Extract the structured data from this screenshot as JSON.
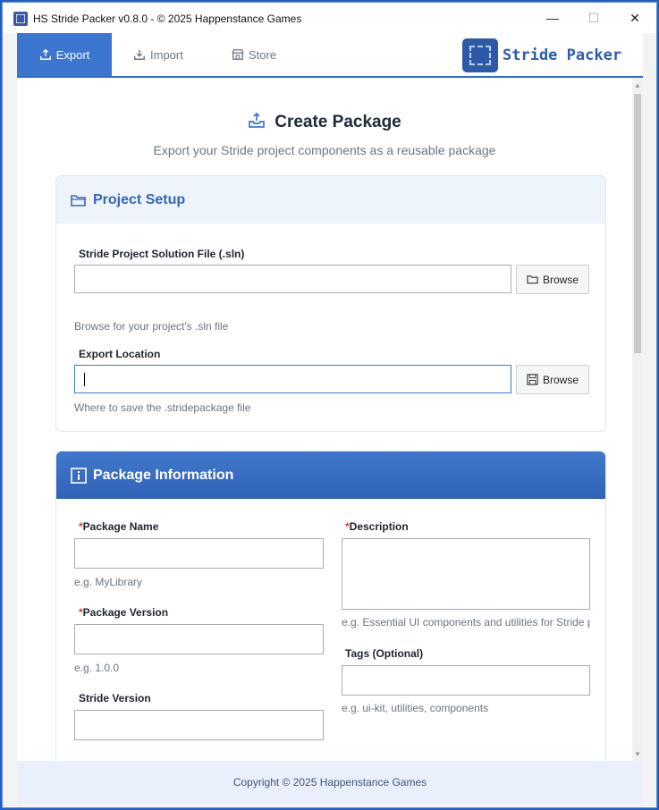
{
  "window": {
    "title": "HS Stride Packer v0.8.0 - © 2025 Happenstance Games",
    "min": "—",
    "max": "☐",
    "close": "✕"
  },
  "nav": {
    "tabs": [
      {
        "label": "Export",
        "icon": "upload-tray-icon",
        "active": true
      },
      {
        "label": "Import",
        "icon": "download-tray-icon",
        "active": false
      },
      {
        "label": "Store",
        "icon": "store-icon",
        "active": false
      }
    ],
    "brand": "Stride Packer"
  },
  "page": {
    "title": "Create Package",
    "subtitle": "Export your Stride project components as a reusable package"
  },
  "project_setup": {
    "heading": "Project Setup",
    "sln_label": "Stride Project Solution File (.sln)",
    "sln_value": "",
    "sln_hint": "Browse for your project's .sln file",
    "browse1": "Browse",
    "export_label": "Export Location",
    "export_value": "",
    "export_hint": "Where to save the .stridepackage file",
    "browse2": "Browse"
  },
  "package_info": {
    "heading": "Package Information",
    "required_mark": "*",
    "name_label": "Package Name",
    "name_hint": "e.g. MyLibrary",
    "version_label": "Package Version",
    "version_hint": "e.g. 1.0.0",
    "stride_version_label": "Stride Version",
    "description_label": "Description",
    "description_hint": "e.g. Essential UI components and utilities for Stride p",
    "tags_label": "Tags (Optional)",
    "tags_hint": "e.g. ui-kit, utilities, components"
  },
  "footer": {
    "text": "Copyright © 2025 Happenstance Games"
  },
  "colors": {
    "accent": "#3d76d1",
    "brand": "#2e5bae",
    "required": "#d23c3c"
  }
}
